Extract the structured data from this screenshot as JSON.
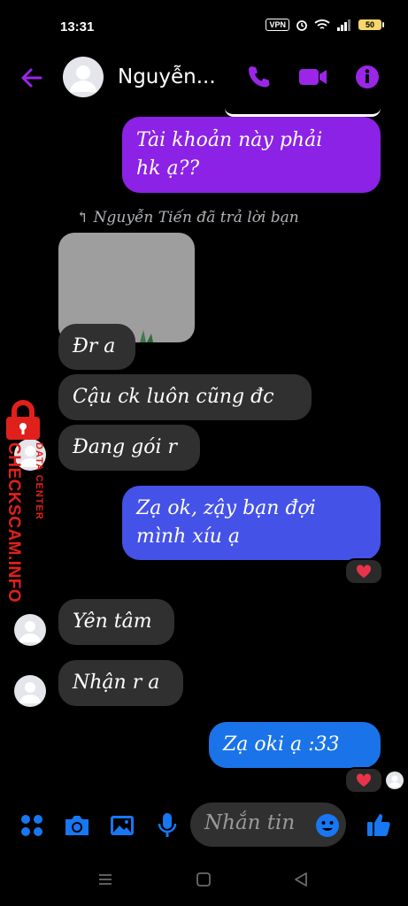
{
  "status_bar": {
    "time": "13:31",
    "vpn_label": "VPN",
    "battery_level": "50",
    "icons": [
      "alarm-icon",
      "wifi-icon",
      "signal-icon",
      "battery-icon"
    ]
  },
  "header": {
    "contact_name": "Nguyễn...",
    "icons": [
      "back-arrow-icon",
      "phone-icon",
      "video-icon",
      "info-icon"
    ],
    "accent_color": "#9b26e8"
  },
  "conversation": {
    "reply_note": "↰ Nguyễn Tiến đã trả lời bạn",
    "messages": [
      {
        "from": "me",
        "text_line1": "Tài khoản này phải",
        "text_line2": "hk ạ??"
      },
      {
        "from": "them",
        "type": "image"
      },
      {
        "from": "them",
        "text": "Đr a"
      },
      {
        "from": "them",
        "text": "Cậu ck luôn cũng đc"
      },
      {
        "from": "them",
        "text": "Đang gói r"
      },
      {
        "from": "me",
        "text_line1": "Zạ ok, zậy bạn đợi",
        "text_line2": "mình xíu ạ",
        "reaction": "heart"
      },
      {
        "from": "them",
        "text": "Yên tâm"
      },
      {
        "from": "them",
        "text": "Nhận r a"
      },
      {
        "from": "me",
        "text": "Zạ oki ạ :33",
        "reaction": "heart"
      }
    ]
  },
  "watermark": {
    "brand": "CHECKSCAM.INFO",
    "subtitle": "DATA CENTER"
  },
  "composer": {
    "placeholder": "Nhắn tin",
    "icons": [
      "menu-dots-icon",
      "camera-icon",
      "gallery-icon",
      "microphone-icon",
      "emoji-icon",
      "like-icon"
    ]
  },
  "colors": {
    "bubble_purple": "#8b22e6",
    "bubble_blue_1": "#4552e8",
    "bubble_blue_2": "#1a73e8",
    "bubble_incoming": "#303030",
    "watermark_red": "#e0201b",
    "composer_blue": "#1877f2"
  }
}
